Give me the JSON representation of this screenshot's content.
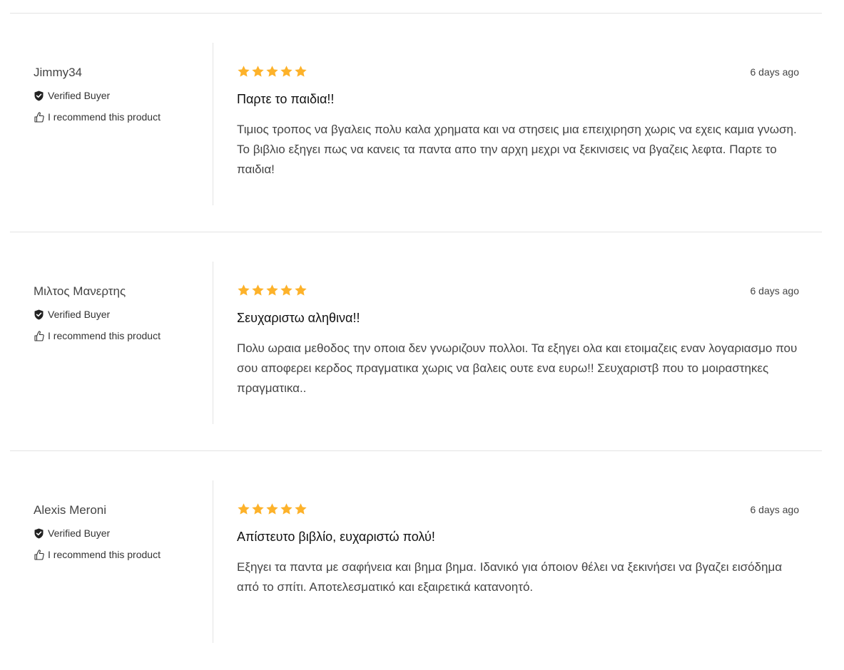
{
  "reviews": [
    {
      "author": "Jimmy34",
      "verified_label": "Verified Buyer",
      "recommend_label": "I recommend this product",
      "rating": 5,
      "date": "6 days ago",
      "title": "Παρτε το παιδια!!",
      "body": "Τιμιος τροπος να βγαλεις πολυ καλα χρηματα και να στησεις μια επειχιρηση χωρις να εχεις καμια γνωση. Το βιβλιο εξηγει πως να κανεις τα παντα απο την αρχη μεχρι να ξεκινισεις να βγαζεις λεφτα. Παρτε το παιδια!"
    },
    {
      "author": "Μιλτος Μανερτης",
      "verified_label": "Verified Buyer",
      "recommend_label": "I recommend this product",
      "rating": 5,
      "date": "6 days ago",
      "title": "Σευχαριστω αληθινα!!",
      "body": "Πολυ ωραια μεθοδος την οποια δεν γνωριζουν πολλοι. Τα εξηγει ολα και ετοιμαζεις εναν λογαριασμο που σου αποφερει κερδος πραγματικα χωρις να βαλεις ουτε ενα ευρω!! Σευχαριστβ που το μοιραστηκες πραγματικα.."
    },
    {
      "author": "Alexis Meroni",
      "verified_label": "Verified Buyer",
      "recommend_label": "I recommend this product",
      "rating": 5,
      "date": "6 days ago",
      "title": "Απίστευτο βιβλίο, ευχαριστώ πολύ!",
      "body": "Εξηγει τα παντα με σαφήνεια και βημα βημα. Ιδανικό για όποιον θέλει να ξεκινήσει να βγαζει εισόδημα από το σπίτι. Αποτελεσματικό και εξαιρετικά κατανοητό."
    }
  ],
  "colors": {
    "star": "#FDB22A",
    "divider": "#e3e3e3",
    "text": "#444444",
    "title": "#111111"
  }
}
